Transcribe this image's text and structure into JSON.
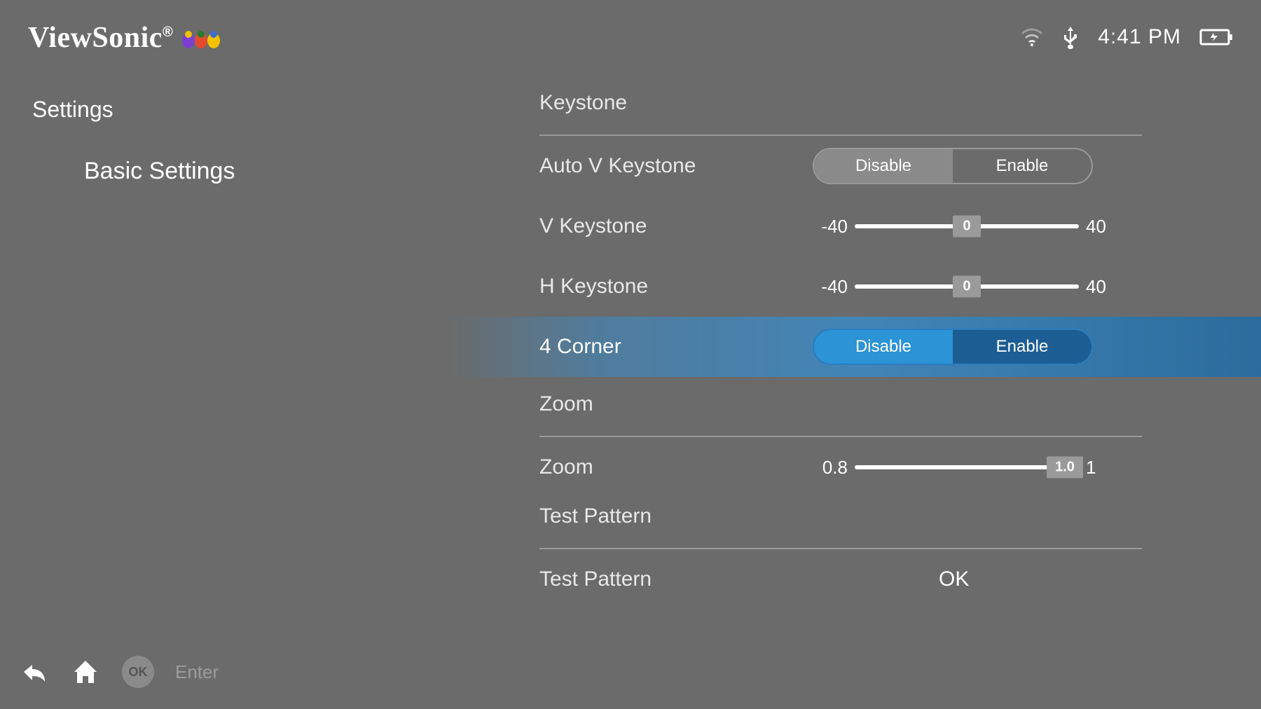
{
  "brand": "ViewSonic",
  "page_title": "Settings",
  "sidebar_item": "Basic Settings",
  "status": {
    "time": "4:41 PM"
  },
  "sections": {
    "keystone": {
      "header": "Keystone",
      "auto_v": {
        "label": "Auto V Keystone",
        "options": [
          "Disable",
          "Enable"
        ],
        "selected": "Disable"
      },
      "v": {
        "label": "V Keystone",
        "min": "-40",
        "max": "40",
        "value": "0",
        "percent": 50
      },
      "h": {
        "label": "H Keystone",
        "min": "-40",
        "max": "40",
        "value": "0",
        "percent": 50
      },
      "four_corner": {
        "label": "4 Corner",
        "options": [
          "Disable",
          "Enable"
        ],
        "selected": "Disable"
      }
    },
    "zoom": {
      "header": "Zoom",
      "zoom": {
        "label": "Zoom",
        "min": "0.8",
        "max": "1",
        "value": "1.0",
        "percent": 100
      }
    },
    "test": {
      "header": "Test Pattern",
      "row": {
        "label": "Test Pattern",
        "value": "OK"
      }
    }
  },
  "footer": {
    "ok": "OK",
    "enter": "Enter"
  }
}
